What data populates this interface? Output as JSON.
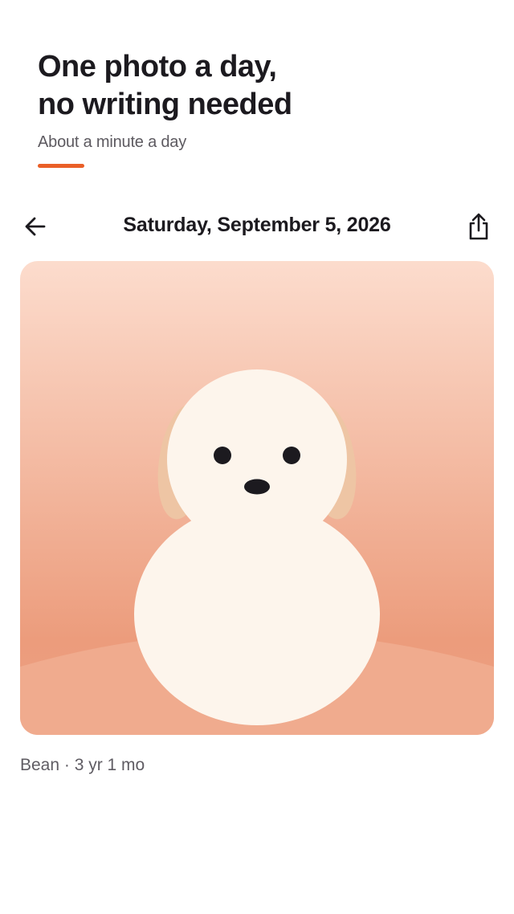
{
  "hero": {
    "title_line1": "One photo a day,",
    "title_line2": "no writing needed",
    "subtitle": "About a minute a day"
  },
  "header": {
    "date": "Saturday, September 5, 2026",
    "back_icon": "arrow-left-icon",
    "share_icon": "share-icon"
  },
  "photo": {
    "subject": "pet-illustration"
  },
  "caption": {
    "text": "Bean · 3 yr 1 mo"
  },
  "colors": {
    "accent": "#ea5f28",
    "text_primary": "#1c1a1f",
    "text_secondary": "#5d5a60",
    "photo_bg_top": "#fcdccd",
    "photo_bg_bottom": "#ec9c7c",
    "subject": "#fdf5ec"
  }
}
